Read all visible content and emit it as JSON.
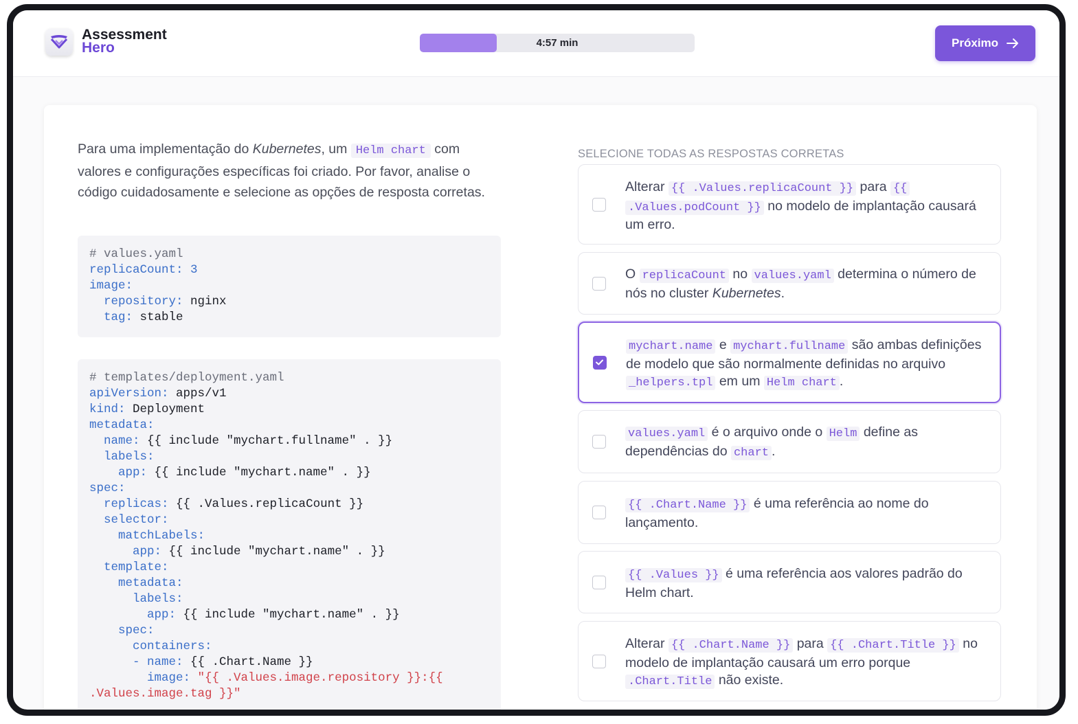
{
  "app": {
    "name_line1": "Assessment",
    "name_line2": "Hero"
  },
  "timer": {
    "label": "4:57 min",
    "progress_fraction": 0.28
  },
  "header": {
    "next_label": "Próximo"
  },
  "question": {
    "p1": "Para uma implementação do ",
    "em1": "Kubernetes",
    "p2": ", um ",
    "code1": "Helm chart",
    "p3": " com valores e configurações específicas foi criado. Por favor, analise o código cuidadosamente e selecione as opções de resposta corretas."
  },
  "code": {
    "values": [
      "# values.yaml",
      "replicaCount: 3",
      "image:",
      "  repository: nginx",
      "  tag: stable"
    ],
    "deployment": [
      "# templates/deployment.yaml",
      "apiVersion: apps/v1",
      "kind: Deployment",
      "metadata:",
      "  name: {{ include \"mychart.fullname\" . }}",
      "  labels:",
      "    app: {{ include \"mychart.name\" . }}",
      "spec:",
      "  replicas: {{ .Values.replicaCount }}",
      "  selector:",
      "    matchLabels:",
      "      app: {{ include \"mychart.name\" . }}",
      "  template:",
      "    metadata:",
      "      labels:",
      "        app: {{ include \"mychart.name\" . }}",
      "    spec:",
      "      containers:",
      "      - name: {{ .Chart.Name }}",
      "        image: \"{{ .Values.image.repository }}:{{",
      ".Values.image.tag }}\""
    ]
  },
  "answers": {
    "instruction": "SELECIONE TODAS AS RESPOSTAS CORRETAS",
    "options": [
      {
        "parts": [
          "Alterar ",
          "{{ .Values.replicaCount }}",
          " para ",
          "{{",
          " ",
          ".Values.podCount }}",
          " no modelo de implantação causará um erro."
        ],
        "checked": false
      },
      {
        "parts": [
          "O ",
          "replicaCount",
          " no ",
          "values.yaml",
          " determina o número de nós no cluster ",
          "Kubernetes",
          "."
        ],
        "checked": false
      },
      {
        "parts": [
          "mychart.name",
          " e ",
          "mychart.fullname",
          " são ambas definições de modelo que são normalmente definidas no arquivo ",
          "_helpers.tpl",
          " em um ",
          "Helm chart",
          "."
        ],
        "checked": true
      },
      {
        "parts": [
          "values.yaml",
          " é o arquivo onde o ",
          "Helm",
          " define as dependências do ",
          "chart",
          "."
        ],
        "checked": false
      },
      {
        "parts": [
          "{{ .Chart.Name }}",
          " é uma referência ao nome do lançamento."
        ],
        "checked": false
      },
      {
        "parts": [
          "{{ .Values }}",
          " é uma referência aos valores padrão do Helm chart."
        ],
        "checked": false
      },
      {
        "parts": [
          "Alterar ",
          "{{ .Chart.Name }}",
          " para ",
          "{{ .Chart.Title }}",
          " no modelo de implantação causará um erro porque ",
          ".Chart.Title",
          " não existe."
        ],
        "checked": false
      }
    ]
  },
  "colors": {
    "accent": "#7b56da",
    "progress_fill": "#a381ec",
    "code_accent": "#7b57d8"
  },
  "icons": {
    "logo": "check-badge-icon",
    "next": "arrow-right-icon",
    "check": "check-icon"
  }
}
